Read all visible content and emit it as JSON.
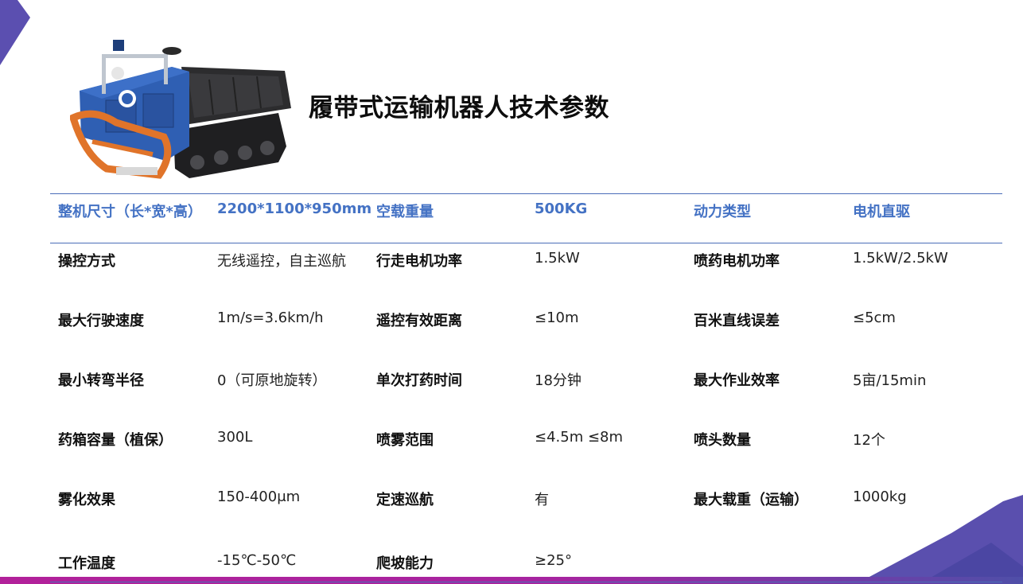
{
  "title": "履带式运输机器人技术参数",
  "colors": {
    "accent": "#4472c4",
    "rule": "#4a6db8",
    "corner": "#5b4fb0",
    "band": "#b2219a"
  },
  "header": [
    "整机尺寸（长*宽*高）",
    "2200*1100*950mm",
    "空载重量",
    "500KG",
    "动力类型",
    "电机直驱"
  ],
  "rows": [
    [
      "操控方式",
      "无线遥控，自主巡航",
      "行走电机功率",
      "1.5kW",
      "喷药电机功率",
      "1.5kW/2.5kW"
    ],
    [
      "最大行驶速度",
      "1m/s=3.6km/h",
      "遥控有效距离",
      "≤10m",
      "百米直线误差",
      "≤5cm"
    ],
    [
      "最小转弯半径",
      "0（可原地旋转）",
      "单次打药时间",
      "18分钟",
      "最大作业效率",
      "5亩/15min"
    ],
    [
      "药箱容量（植保）",
      "300L",
      "喷雾范围",
      "≤4.5m ≤8m",
      "喷头数量",
      "12个"
    ],
    [
      "雾化效果",
      "150-400μm",
      "定速巡航",
      "有",
      "最大载重（运输）",
      "1000kg"
    ],
    [
      "工作温度",
      "-15℃-50℃",
      "爬坡能力",
      "≥25°",
      "",
      ""
    ]
  ]
}
